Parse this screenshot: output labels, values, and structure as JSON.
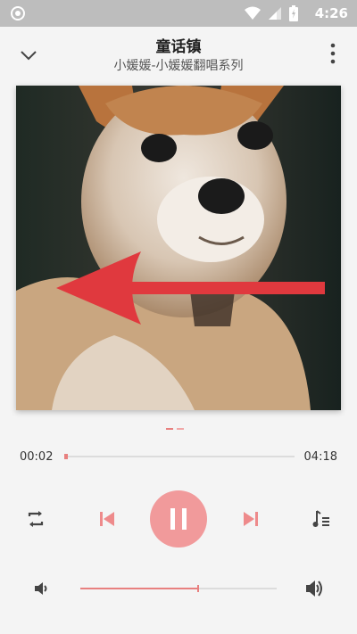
{
  "status_bar": {
    "time": "4:26"
  },
  "header": {
    "title": "童话镇",
    "subtitle": "小媛媛-小媛媛翻唱系列"
  },
  "album_art": {
    "description_icon": "puppy-photo"
  },
  "pager": {
    "pages": 2,
    "active": 0
  },
  "progress": {
    "current": "00:02",
    "total": "04:18",
    "fraction": 0.008
  },
  "controls": {
    "repeat_icon": "repeat-icon",
    "prev_icon": "skip-previous-icon",
    "play_state": "paused-button",
    "next_icon": "skip-next-icon",
    "playlist_icon": "playlist-icon"
  },
  "volume": {
    "fraction": 0.6
  },
  "colors": {
    "accent": "#e8807f",
    "accent_light": "#f19a9b",
    "status_bar": "#bdbdbd"
  }
}
